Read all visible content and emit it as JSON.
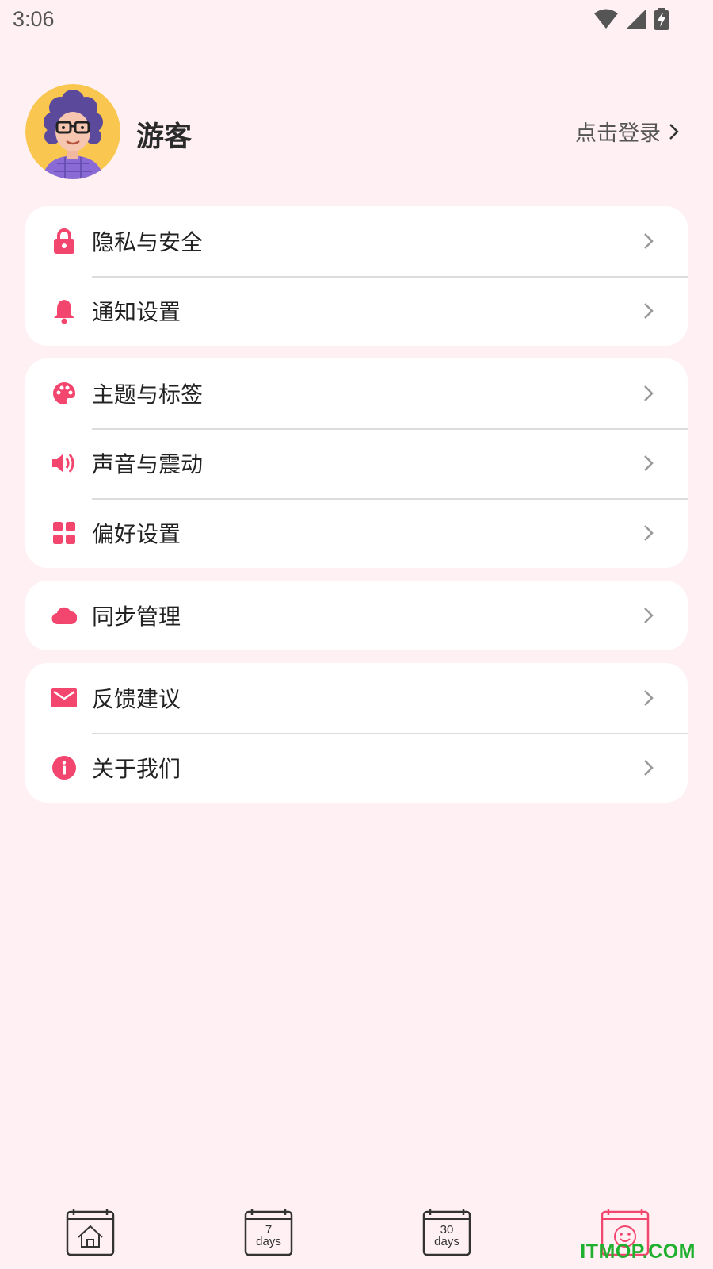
{
  "status_bar": {
    "time": "3:06"
  },
  "profile": {
    "name": "游客",
    "login_label": "点击登录"
  },
  "cards": [
    {
      "items": [
        {
          "icon": "lock-icon",
          "label": "隐私与安全"
        },
        {
          "icon": "bell-icon",
          "label": "通知设置"
        }
      ]
    },
    {
      "items": [
        {
          "icon": "palette-icon",
          "label": "主题与标签"
        },
        {
          "icon": "speaker-icon",
          "label": "声音与震动"
        },
        {
          "icon": "grid-icon",
          "label": "偏好设置"
        }
      ]
    },
    {
      "items": [
        {
          "icon": "cloud-icon",
          "label": "同步管理"
        }
      ]
    },
    {
      "items": [
        {
          "icon": "mail-icon",
          "label": "反馈建议"
        },
        {
          "icon": "info-icon",
          "label": "关于我们"
        }
      ]
    }
  ],
  "tabbar": {
    "tabs": [
      {
        "icon": "home-calendar-icon"
      },
      {
        "icon": "seven-days-calendar-icon",
        "number": "7",
        "unit": "days"
      },
      {
        "icon": "thirty-days-calendar-icon",
        "number": "30",
        "unit": "days"
      },
      {
        "icon": "smiley-calendar-icon",
        "active": true
      }
    ]
  },
  "watermark": "ITMOP.COM",
  "colors": {
    "accent": "#f3466f",
    "background": "#fff0f3",
    "card": "#ffffff"
  }
}
